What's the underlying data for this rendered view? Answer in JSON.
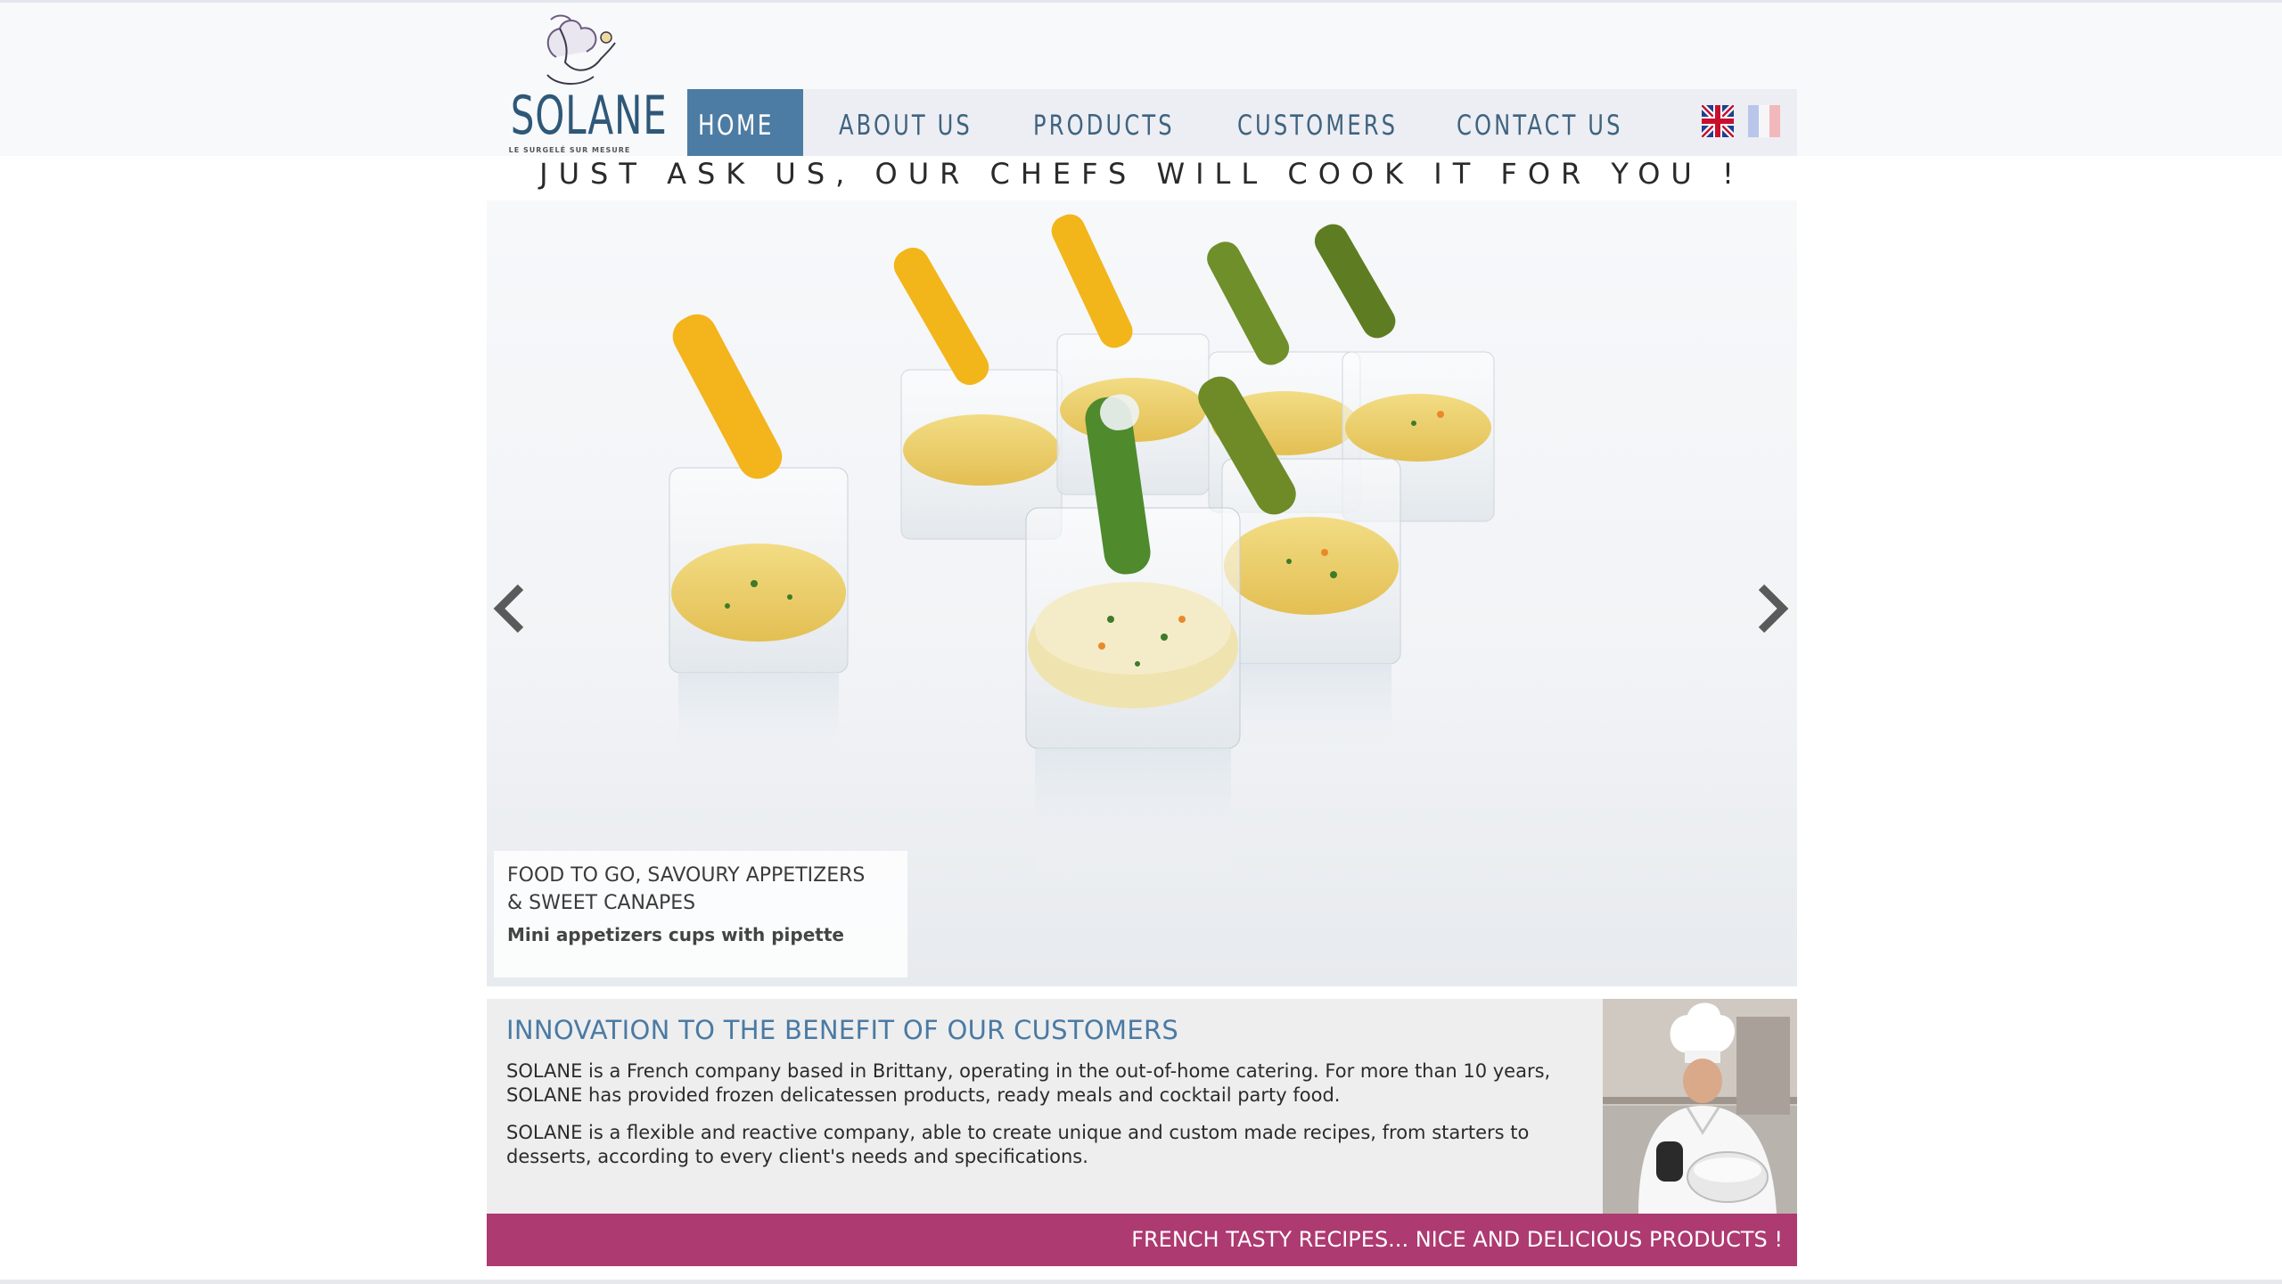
{
  "brand": {
    "name": "SOLANE",
    "tagline": "LE SURGELÉ SUR MESURE"
  },
  "nav": {
    "items": [
      {
        "label": "HOME"
      },
      {
        "label": "ABOUT US"
      },
      {
        "label": "PRODUCTS"
      },
      {
        "label": "CUSTOMERS"
      },
      {
        "label": "CONTACT US"
      }
    ],
    "active": "HOME"
  },
  "header": {
    "slogan": "JUST ASK US, OUR CHEFS WILL COOK IT FOR YOU !"
  },
  "slider": {
    "caption_line1": "FOOD TO GO, SAVOURY APPETIZERS",
    "caption_line2": "& SWEET CANAPES",
    "caption_sub": "Mini appetizers cups with pipette"
  },
  "info": {
    "title": "INNOVATION TO THE BENEFIT OF OUR CUSTOMERS",
    "paragraph1": "SOLANE is a French company based in Brittany, operating in the out-of-home catering. For more than 10 years, SOLANE has provided frozen delicatessen products, ready meals and cocktail party food.",
    "paragraph2": "SOLANE is a flexible and reactive company, able to create unique and custom made recipes, from starters to desserts, according to every client's needs and specifications."
  },
  "banner": {
    "text": "FRENCH TASTY RECIPES... NICE AND DELICIOUS PRODUCTS !"
  },
  "colors": {
    "nav_active": "#4c7ca3",
    "nav_text": "#3f6380",
    "info_title": "#4a7aa3",
    "banner": "#ad3a70"
  },
  "icons": {
    "prev": "chevron-left-icon",
    "next": "chevron-right-icon",
    "flag_en": "uk-flag-icon",
    "flag_fr": "france-flag-icon"
  }
}
